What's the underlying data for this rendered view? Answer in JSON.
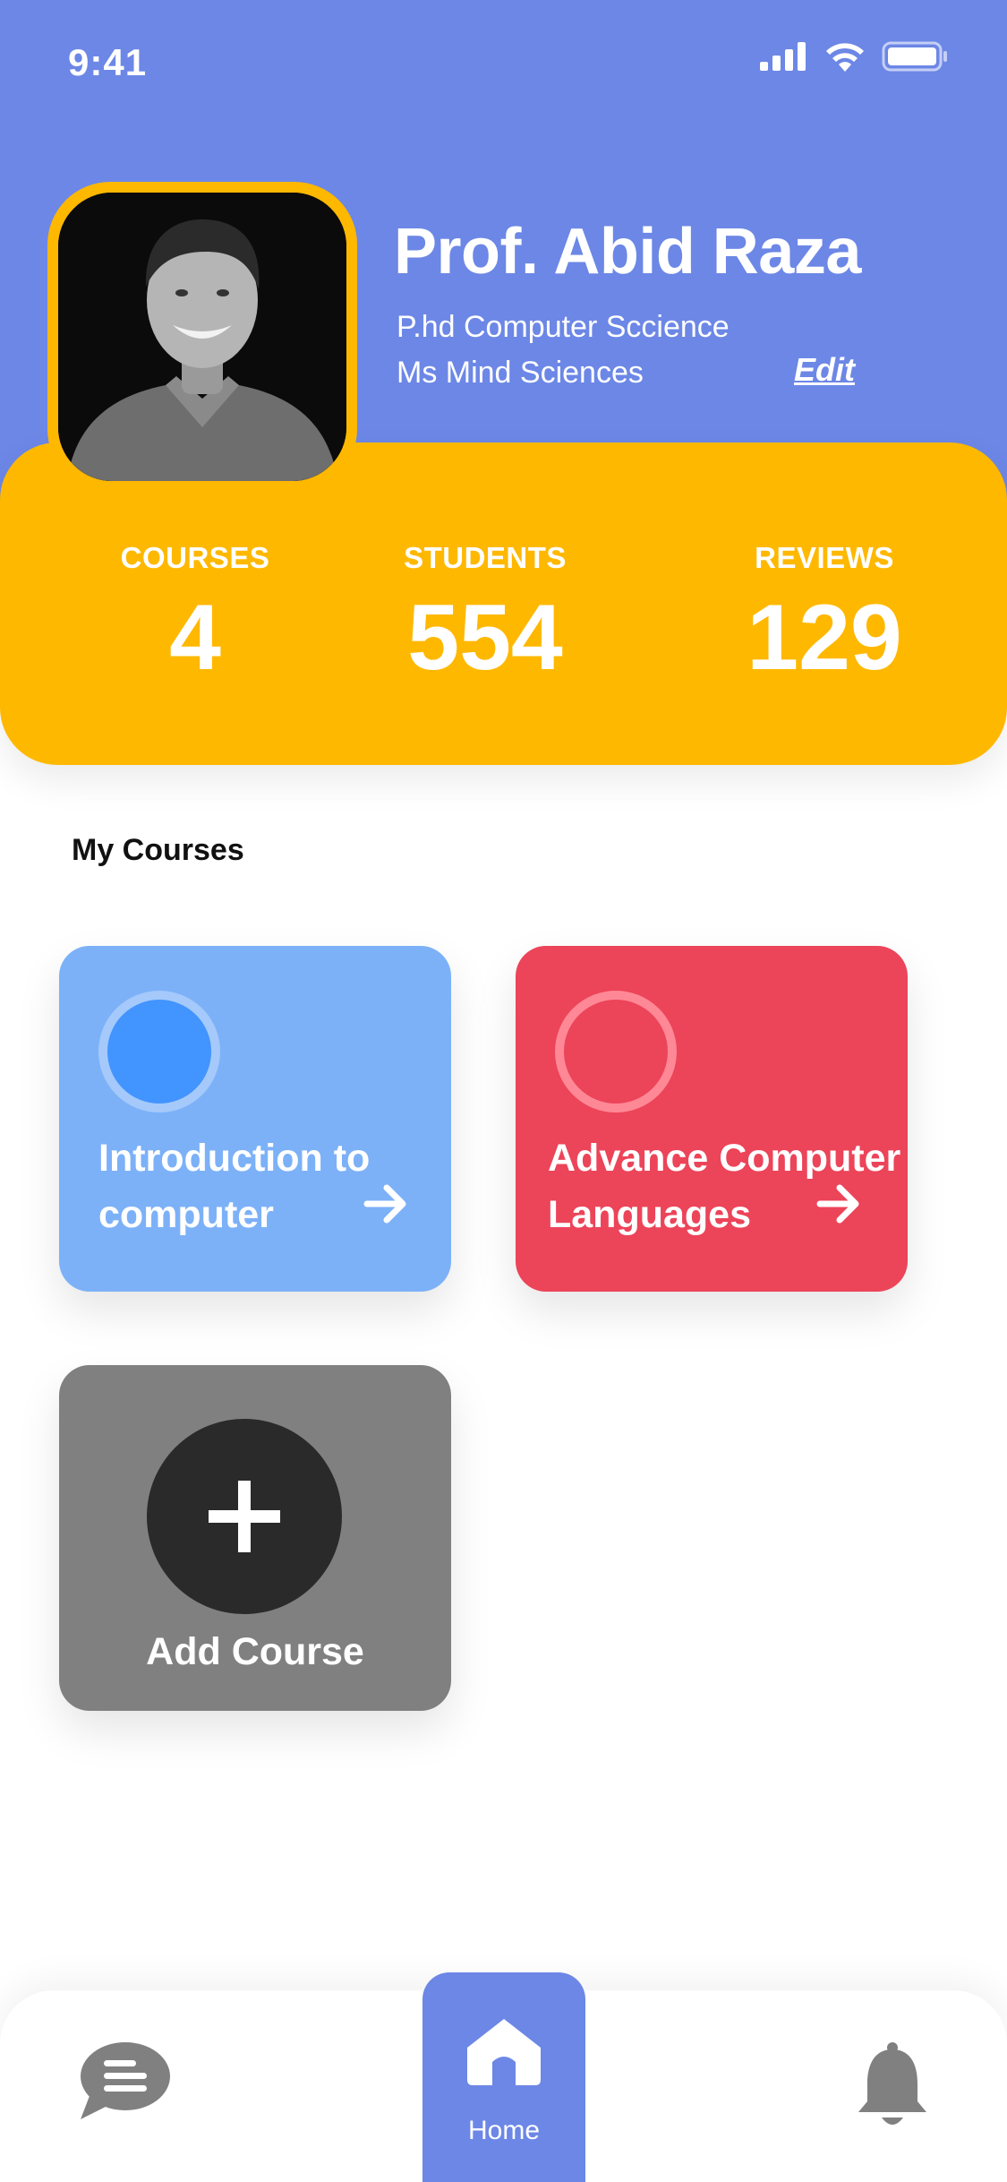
{
  "status_bar": {
    "time": "9:41"
  },
  "profile": {
    "name": "Prof. Abid Raza",
    "line1": "P.hd Computer Sccience",
    "line2": "Ms Mind Sciences",
    "edit_label": "Edit"
  },
  "stats": [
    {
      "label": "COURSES",
      "value": "4"
    },
    {
      "label": "STUDENTS",
      "value": "554"
    },
    {
      "label": "REVIEWS",
      "value": "129"
    }
  ],
  "section_title": "My Courses",
  "courses": [
    {
      "title": "Introduction to computer",
      "color": "#7CB1F8",
      "icon": "arrow-right-icon"
    },
    {
      "title": "Advance Computer Languages",
      "color": "#EC4459",
      "icon": "arrow-right-icon"
    }
  ],
  "add_course": {
    "label": "Add Course",
    "icon": "plus-icon"
  },
  "nav": {
    "items": [
      {
        "name": "chat",
        "icon": "chat-bubble-icon"
      },
      {
        "name": "home",
        "icon": "home-icon",
        "label": "Home"
      },
      {
        "name": "notifications",
        "icon": "bell-icon"
      }
    ]
  },
  "colors": {
    "header": "#6C87E6",
    "accent": "#FFB800",
    "nav_active": "#6C87E6",
    "add_card": "#808080"
  }
}
